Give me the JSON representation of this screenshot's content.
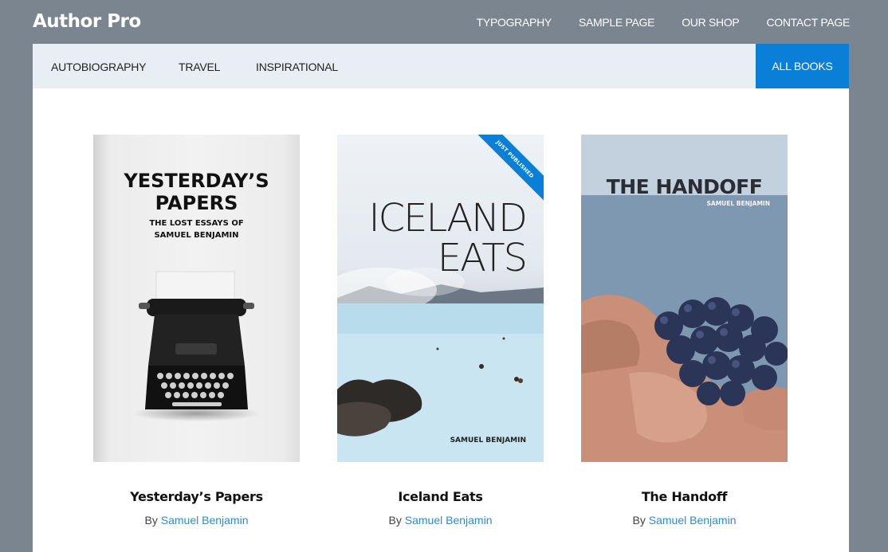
{
  "site": {
    "title": "Author Pro"
  },
  "nav": {
    "items": [
      "TYPOGRAPHY",
      "SAMPLE PAGE",
      "OUR SHOP",
      "CONTACT PAGE"
    ]
  },
  "categories": {
    "items": [
      "AUTOBIOGRAPHY",
      "TRAVEL",
      "INSPIRATIONAL"
    ],
    "all_books": "ALL BOOKS"
  },
  "colors": {
    "accent": "#0a7fd8",
    "link": "#2b8ad8",
    "page_bg": "#7a8590",
    "category_bar": "#e8eef3"
  },
  "books": [
    {
      "title": "Yesterday’s Papers",
      "by": "By",
      "author": "Samuel Benjamin",
      "cover": {
        "title_line1": "YESTERDAY’S",
        "title_line2": "PAPERS",
        "subtitle_line1": "THE LOST ESSAYS OF",
        "subtitle_line2": "SAMUEL BENJAMIN",
        "image": "typewriter"
      }
    },
    {
      "title": "Iceland Eats",
      "by": "By",
      "author": "Samuel Benjamin",
      "cover": {
        "title_line1": "ICELAND",
        "title_line2": "EATS",
        "author": "SAMUEL BENJAMIN",
        "ribbon": "JUST PUBLISHED",
        "image": "hot-spring-lagoon"
      }
    },
    {
      "title": "The Handoff",
      "by": "By",
      "author": "Samuel Benjamin",
      "cover": {
        "title": "THE HANDOFF",
        "author": "SAMUEL BENJAMIN",
        "image": "hand-holding-grapes"
      }
    }
  ]
}
